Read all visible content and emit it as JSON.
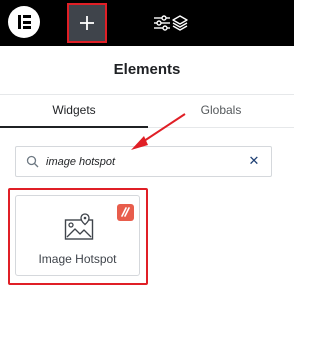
{
  "toolbar": {
    "logo_icon": "elementor-logo-icon",
    "add_icon": "plus-icon",
    "settings_icon": "sliders-icon",
    "layers_icon": "layers-icon",
    "highlight_color": "#e01f26"
  },
  "panel": {
    "title": "Elements"
  },
  "tabs": [
    {
      "label": "Widgets",
      "active": true
    },
    {
      "label": "Globals",
      "active": false
    }
  ],
  "search": {
    "value": "image hotspot",
    "clear_icon": "close-icon"
  },
  "widgets": [
    {
      "label": "Image Hotspot",
      "icon": "image-pin-icon",
      "pro_badge": true,
      "badge_color": "#e85d4c"
    }
  ],
  "annotation": {
    "arrow_color": "#e01f26"
  }
}
